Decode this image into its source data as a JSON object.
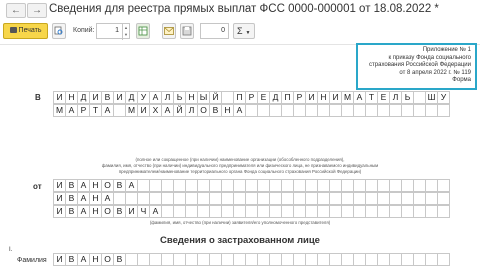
{
  "window": {
    "back_icon": "arrow-left-icon",
    "forward_icon": "arrow-right-icon",
    "title": "Сведения для реестра прямых выплат ФСС 0000-000001 от 18.08.2022 *"
  },
  "toolbar": {
    "print_label": "Печать",
    "copies_label": "Копий:",
    "copies_value": "1",
    "number_value": "0",
    "sum_symbol": "Σ",
    "icons": [
      "printer-icon",
      "print-preview-icon",
      "table-icon",
      "envelope-icon",
      "save-icon",
      "sum-icon"
    ]
  },
  "appendix": {
    "lines": [
      "Приложение № 1",
      "к приказу Фонда социального",
      "страхования Российской Федерации",
      "от 8 апреля 2022 г. № 119",
      "Форма"
    ]
  },
  "form": {
    "to_label": "В",
    "to_line1": "ИНДИВИДУАЛЬНЫЙ ПРЕДПРИНИМАТЕЛЬ ШУМИХИНА",
    "to_line2": "МАРТА МИХАЙЛОВНА",
    "to_caption_1": "(полное или сокращенное (при наличии) наименование организации (обособленного подразделения),",
    "to_caption_2": "фамилия, имя, отчество (при наличии) индивидуального предпринимателя или физического лица, не признаваемого индивидуальным",
    "to_caption_3": "предпринимателем/наименование территориального органа Фонда социального страхования Российской Федерации)",
    "from_label": "от",
    "from_line1": "ИВАНОВА",
    "from_line2": "ИВАНА",
    "from_line3": "ИВАНОВИЧА",
    "from_caption": "(фамилия, имя, отчество (при наличии) заявителя/его уполномоченного представителя)",
    "section_title": "Сведения о застрахованном лице",
    "section_number": "I.",
    "surname_label": "Фамилия",
    "surname_value": "ИВАНОВ"
  }
}
